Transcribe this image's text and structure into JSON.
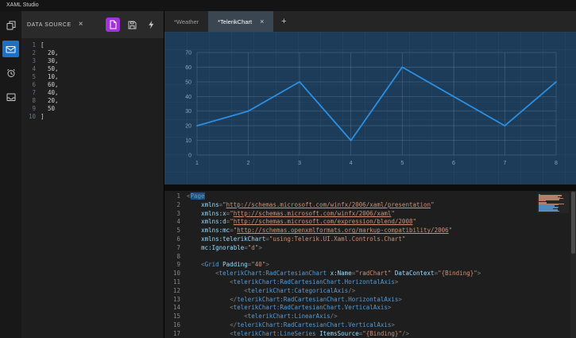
{
  "colors": {
    "plain": "#d4d4d4",
    "w": "#d4d4d4",
    "p": "#808080",
    "t": "#569cd6",
    "ts": "#569cd6",
    "a": "#9cdcfe",
    "s": "#ce9178",
    "sl": "#ce9178",
    "selection": "#264f78",
    "accent_blue": "#1b70c8",
    "accent_purple": "#a233d9"
  },
  "titlebar": {
    "title": "XAML Studio"
  },
  "icons": {
    "close": "×",
    "add": "+"
  },
  "activity_bar": {
    "items": [
      {
        "icon": "copy-pages",
        "active": false
      },
      {
        "icon": "mail",
        "active": true
      },
      {
        "icon": "alarm-clock",
        "active": false
      },
      {
        "icon": "inbox-tray",
        "active": false
      }
    ]
  },
  "data_source": {
    "title": "DATA SOURCE",
    "lines": [
      {
        "num": 1,
        "text": "["
      },
      {
        "num": 2,
        "text": "  20,"
      },
      {
        "num": 3,
        "text": "  30,"
      },
      {
        "num": 4,
        "text": "  50,"
      },
      {
        "num": 5,
        "text": "  10,"
      },
      {
        "num": 6,
        "text": "  60,"
      },
      {
        "num": 7,
        "text": "  40,"
      },
      {
        "num": 8,
        "text": "  20,"
      },
      {
        "num": 9,
        "text": "  50"
      },
      {
        "num": 10,
        "text": "]"
      }
    ]
  },
  "tabs": {
    "items": [
      {
        "label": "*Weather",
        "active": false
      },
      {
        "label": "*TelerikChart",
        "active": true
      }
    ]
  },
  "chart_data": {
    "type": "line",
    "title": "",
    "xlabel": "",
    "ylabel": "",
    "x": [
      1,
      2,
      3,
      4,
      5,
      6,
      7,
      8
    ],
    "values": [
      20,
      30,
      50,
      10,
      60,
      40,
      20,
      50
    ],
    "xticks": [
      1,
      2,
      3,
      4,
      5,
      6,
      7,
      8
    ],
    "yticks": [
      0,
      10,
      20,
      30,
      40,
      50,
      60,
      70
    ],
    "xlim": [
      1,
      8
    ],
    "ylim": [
      0,
      70
    ],
    "grid": true,
    "legend": false,
    "line_color": "#2b8fe2",
    "background": "#1d3c59"
  },
  "code_editor": {
    "lines": [
      {
        "num": 1,
        "tokens": [
          [
            "<",
            "p"
          ],
          [
            "Page",
            "ts"
          ]
        ]
      },
      {
        "num": 2,
        "tokens": [
          [
            "    ",
            "w"
          ],
          [
            "xmlns",
            "a"
          ],
          [
            "=",
            "p"
          ],
          [
            "\"",
            "s"
          ],
          [
            "http://schemas.microsoft.com/winfx/2006/xaml/presentation",
            "sl"
          ],
          [
            "\"",
            "s"
          ]
        ]
      },
      {
        "num": 3,
        "tokens": [
          [
            "    ",
            "w"
          ],
          [
            "xmlns:x",
            "a"
          ],
          [
            "=",
            "p"
          ],
          [
            "\"",
            "s"
          ],
          [
            "http://schemas.microsoft.com/winfx/2006/xaml",
            "sl"
          ],
          [
            "\"",
            "s"
          ]
        ]
      },
      {
        "num": 4,
        "tokens": [
          [
            "    ",
            "w"
          ],
          [
            "xmlns:d",
            "a"
          ],
          [
            "=",
            "p"
          ],
          [
            "\"",
            "s"
          ],
          [
            "http://schemas.microsoft.com/expression/blend/2008",
            "sl"
          ],
          [
            "\"",
            "s"
          ]
        ]
      },
      {
        "num": 5,
        "tokens": [
          [
            "    ",
            "w"
          ],
          [
            "xmlns:mc",
            "a"
          ],
          [
            "=",
            "p"
          ],
          [
            "\"",
            "s"
          ],
          [
            "http://schemas.openxmlformats.org/markup-compatibility/2006",
            "sl"
          ],
          [
            "\"",
            "s"
          ]
        ]
      },
      {
        "num": 6,
        "tokens": [
          [
            "    ",
            "w"
          ],
          [
            "xmlns:telerikChart",
            "a"
          ],
          [
            "=",
            "p"
          ],
          [
            "\"using:Telerik.UI.Xaml.Controls.Chart\"",
            "s"
          ]
        ]
      },
      {
        "num": 7,
        "tokens": [
          [
            "    ",
            "w"
          ],
          [
            "mc:Ignorable",
            "a"
          ],
          [
            "=",
            "p"
          ],
          [
            "\"d\"",
            "s"
          ],
          [
            ">",
            "p"
          ]
        ]
      },
      {
        "num": 8,
        "tokens": []
      },
      {
        "num": 9,
        "tokens": [
          [
            "    ",
            "w"
          ],
          [
            "<",
            "p"
          ],
          [
            "Grid",
            "t"
          ],
          [
            " ",
            "w"
          ],
          [
            "Padding",
            "a"
          ],
          [
            "=",
            "p"
          ],
          [
            "\"40\"",
            "s"
          ],
          [
            ">",
            "p"
          ]
        ]
      },
      {
        "num": 10,
        "tokens": [
          [
            "        ",
            "w"
          ],
          [
            "<",
            "p"
          ],
          [
            "telerikChart:RadCartesianChart",
            "t"
          ],
          [
            " ",
            "w"
          ],
          [
            "x:Name",
            "a"
          ],
          [
            "=",
            "p"
          ],
          [
            "\"radChart\"",
            "s"
          ],
          [
            " ",
            "w"
          ],
          [
            "DataContext",
            "a"
          ],
          [
            "=",
            "p"
          ],
          [
            "\"{Binding}\"",
            "s"
          ],
          [
            ">",
            "p"
          ]
        ]
      },
      {
        "num": 11,
        "tokens": [
          [
            "            ",
            "w"
          ],
          [
            "<",
            "p"
          ],
          [
            "telerikChart:RadCartesianChart.HorizontalAxis",
            "t"
          ],
          [
            ">",
            "p"
          ]
        ]
      },
      {
        "num": 12,
        "tokens": [
          [
            "                ",
            "w"
          ],
          [
            "<",
            "p"
          ],
          [
            "telerikChart:CategoricalAxis",
            "t"
          ],
          [
            "/>",
            "p"
          ]
        ]
      },
      {
        "num": 13,
        "tokens": [
          [
            "            ",
            "w"
          ],
          [
            "</",
            "p"
          ],
          [
            "telerikChart:RadCartesianChart.HorizontalAxis",
            "t"
          ],
          [
            ">",
            "p"
          ]
        ]
      },
      {
        "num": 14,
        "tokens": [
          [
            "            ",
            "w"
          ],
          [
            "<",
            "p"
          ],
          [
            "telerikChart:RadCartesianChart.VerticalAxis",
            "t"
          ],
          [
            ">",
            "p"
          ]
        ]
      },
      {
        "num": 15,
        "tokens": [
          [
            "                ",
            "w"
          ],
          [
            "<",
            "p"
          ],
          [
            "telerikChart:LinearAxis",
            "t"
          ],
          [
            "/>",
            "p"
          ]
        ]
      },
      {
        "num": 16,
        "tokens": [
          [
            "            ",
            "w"
          ],
          [
            "</",
            "p"
          ],
          [
            "telerikChart:RadCartesianChart.VerticalAxis",
            "t"
          ],
          [
            ">",
            "p"
          ]
        ]
      },
      {
        "num": 17,
        "tokens": [
          [
            "            ",
            "w"
          ],
          [
            "<",
            "p"
          ],
          [
            "telerikChart:LineSeries",
            "t"
          ],
          [
            " ",
            "w"
          ],
          [
            "ItemsSource",
            "a"
          ],
          [
            "=",
            "p"
          ],
          [
            "\"{Binding}\"",
            "s"
          ],
          [
            "/>",
            "p"
          ]
        ]
      }
    ]
  }
}
